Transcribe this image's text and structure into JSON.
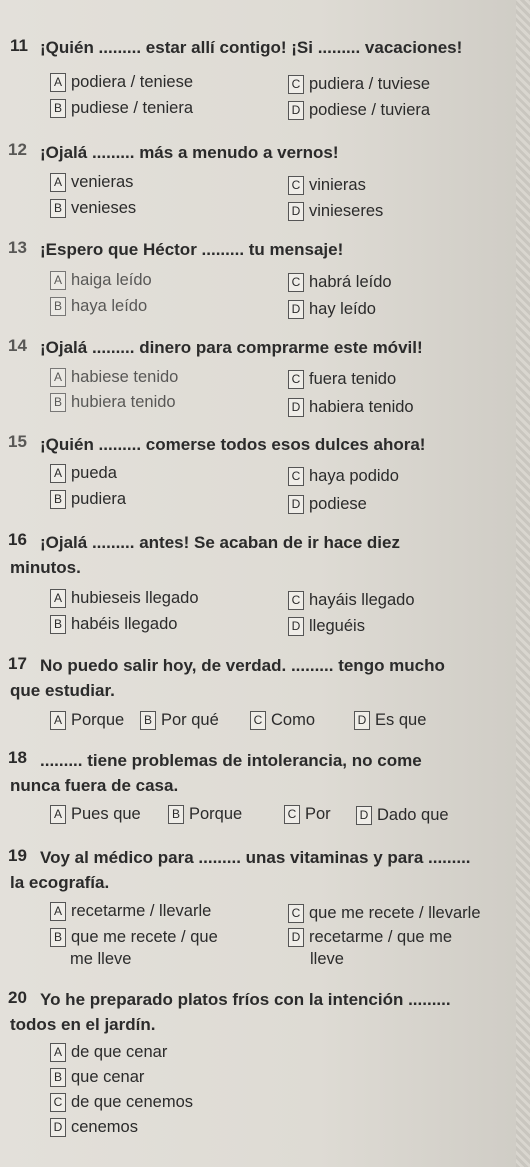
{
  "questions": [
    {
      "num": "11",
      "text": "¡Quién ......... estar allí contigo! ¡Si ......... vacaciones!",
      "options": {
        "A": "podiera / teniese",
        "B": "pudiese / teniera",
        "C": "pudiera / tuviese",
        "D": "podiese / tuviera"
      }
    },
    {
      "num": "12",
      "text": "¡Ojalá ......... más a menudo a vernos!",
      "options": {
        "A": "venieras",
        "B": "venieses",
        "C": "vinieras",
        "D": "vinieseres"
      }
    },
    {
      "num": "13",
      "text": "¡Espero que Héctor ......... tu mensaje!",
      "options": {
        "A": "haiga leído",
        "B": "haya leído",
        "C": "habrá leído",
        "D": "hay leído"
      }
    },
    {
      "num": "14",
      "text": "¡Ojalá ......... dinero para comprarme este móvil!",
      "options": {
        "A": "habiese tenido",
        "B": "hubiera tenido",
        "C": "fuera tenido",
        "D": "habiera tenido"
      }
    },
    {
      "num": "15",
      "text": "¡Quién ......... comerse todos esos dulces ahora!",
      "options": {
        "A": "pueda",
        "B": "pudiera",
        "C": "haya podido",
        "D": "podiese"
      }
    },
    {
      "num": "16",
      "text_line1": "¡Ojalá ......... antes! Se acaban de ir hace diez",
      "text_line2": "minutos.",
      "options": {
        "A": "hubieseis llegado",
        "B": "habéis llegado",
        "C": "hayáis llegado",
        "D": "lleguéis"
      }
    },
    {
      "num": "17",
      "text_line1": "No puedo salir hoy, de verdad. ......... tengo mucho",
      "text_line2": "que estudiar.",
      "options": {
        "A": "Porque",
        "B": "Por qué",
        "C": "Como",
        "D": "Es que"
      }
    },
    {
      "num": "18",
      "text_line1": "......... tiene problemas de intolerancia, no come",
      "text_line2": "nunca fuera de casa.",
      "options": {
        "A": "Pues que",
        "B": "Porque",
        "C": "Por",
        "D": "Dado que"
      }
    },
    {
      "num": "19",
      "text_line1": "Voy al médico para ......... unas vitaminas y para .........",
      "text_line2": "la ecografía.",
      "options": {
        "A": "recetarme / llevarle",
        "B_line1": "que me recete / que",
        "B_line2": "me lleve",
        "C": "que me recete / llevarle",
        "D_line1": "recetarme / que me",
        "D_line2": "lleve"
      }
    },
    {
      "num": "20",
      "text_line1": "Yo he preparado platos fríos con la intención .........",
      "text_line2": "todos en el jardín.",
      "options": {
        "A": "de que cenar",
        "B": "que cenar",
        "C": "de que cenemos",
        "D": "cenemos"
      }
    }
  ],
  "letters": {
    "A": "A",
    "B": "B",
    "C": "C",
    "D": "D"
  }
}
